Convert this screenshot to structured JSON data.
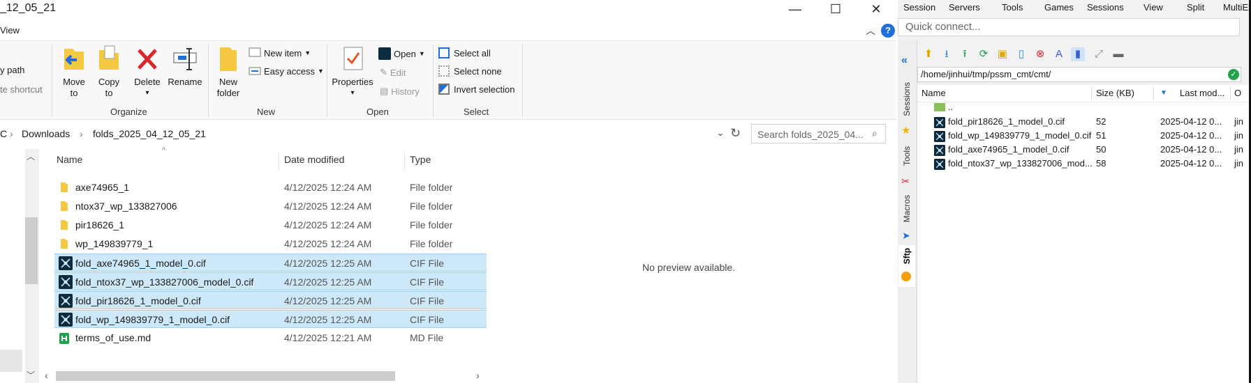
{
  "explorer": {
    "title": "_12_05_21",
    "window_controls": {
      "minimize": "—",
      "maximize": "☐",
      "close": "✕"
    },
    "menu_view": "View",
    "ribbon": {
      "clipboard": {
        "copy_path": "y path",
        "paste_shortcut": "te shortcut"
      },
      "organize": {
        "label": "Organize",
        "move_to_1": "Move",
        "move_to_2": "to",
        "copy_to_1": "Copy",
        "copy_to_2": "to",
        "delete": "Delete",
        "rename": "Rename"
      },
      "new": {
        "label": "New",
        "new_folder_1": "New",
        "new_folder_2": "folder",
        "new_item": "New item",
        "easy_access": "Easy access"
      },
      "open": {
        "label": "Open",
        "properties": "Properties",
        "open": "Open",
        "edit": "Edit",
        "history": "History"
      },
      "select": {
        "label": "Select",
        "select_all": "Select all",
        "select_none": "Select none",
        "invert_selection": "Invert selection"
      },
      "help": "?"
    },
    "address": {
      "crumbs": [
        "C",
        "Downloads",
        "folds_2025_04_12_05_21"
      ],
      "search_placeholder": "Search folds_2025_04..."
    },
    "columns": {
      "name": "Name",
      "date": "Date modified",
      "type": "Type"
    },
    "files": [
      {
        "name": "axe74965_1",
        "date": "4/12/2025 12:24 AM",
        "type": "File folder",
        "icon": "folder-icon",
        "selected": false
      },
      {
        "name": "ntox37_wp_133827006",
        "date": "4/12/2025 12:24 AM",
        "type": "File folder",
        "icon": "folder-icon",
        "selected": false
      },
      {
        "name": "pir18626_1",
        "date": "4/12/2025 12:24 AM",
        "type": "File folder",
        "icon": "folder-icon",
        "selected": false
      },
      {
        "name": "wp_149839779_1",
        "date": "4/12/2025 12:24 AM",
        "type": "File folder",
        "icon": "folder-icon",
        "selected": false
      },
      {
        "name": "fold_axe74965_1_model_0.cif",
        "date": "4/12/2025 12:25 AM",
        "type": "CIF File",
        "icon": "cif-file-icon",
        "selected": true
      },
      {
        "name": "fold_ntox37_wp_133827006_model_0.cif",
        "date": "4/12/2025 12:25 AM",
        "type": "CIF File",
        "icon": "cif-file-icon",
        "selected": true
      },
      {
        "name": "fold_pir18626_1_model_0.cif",
        "date": "4/12/2025 12:25 AM",
        "type": "CIF File",
        "icon": "cif-file-icon",
        "selected": true
      },
      {
        "name": "fold_wp_149839779_1_model_0.cif",
        "date": "4/12/2025 12:25 AM",
        "type": "CIF File",
        "icon": "cif-file-icon",
        "selected": true
      },
      {
        "name": "terms_of_use.md",
        "date": "4/12/2025 12:21 AM",
        "type": "MD File",
        "icon": "markdown-file-icon",
        "selected": false
      }
    ],
    "preview_text": "No preview available."
  },
  "moba": {
    "menu": [
      "Session",
      "Servers",
      "Tools",
      "Games",
      "Sessions",
      "View",
      "Split",
      "MultiEx"
    ],
    "quick_connect_placeholder": "Quick connect...",
    "side_tabs": [
      "Sessions",
      "Tools",
      "Macros",
      "Sftp"
    ],
    "path": "/home/jinhui/tmp/pssm_cmt/cmt/",
    "columns": {
      "name": "Name",
      "size": "Size (KB)",
      "modified": "Last mod...",
      "owner": "O"
    },
    "parent": "..",
    "files": [
      {
        "name": "fold_pir18626_1_model_0.cif",
        "size": "52",
        "modified": "2025-04-12 0...",
        "owner": "jin"
      },
      {
        "name": "fold_wp_149839779_1_model_0.cif",
        "size": "51",
        "modified": "2025-04-12 0...",
        "owner": "jin"
      },
      {
        "name": "fold_axe74965_1_model_0.cif",
        "size": "50",
        "modified": "2025-04-12 0...",
        "owner": "jin"
      },
      {
        "name": "fold_ntox37_wp_133827006_mod...",
        "size": "58",
        "modified": "2025-04-12 0...",
        "owner": "jin"
      }
    ]
  },
  "colors": {
    "selection": "#cde8f9",
    "selection_border": "#99d1ff",
    "accent_blue": "#1e6fd9",
    "delete_red": "#d9252e",
    "cif_icon_bg": "#0d2b3e"
  }
}
